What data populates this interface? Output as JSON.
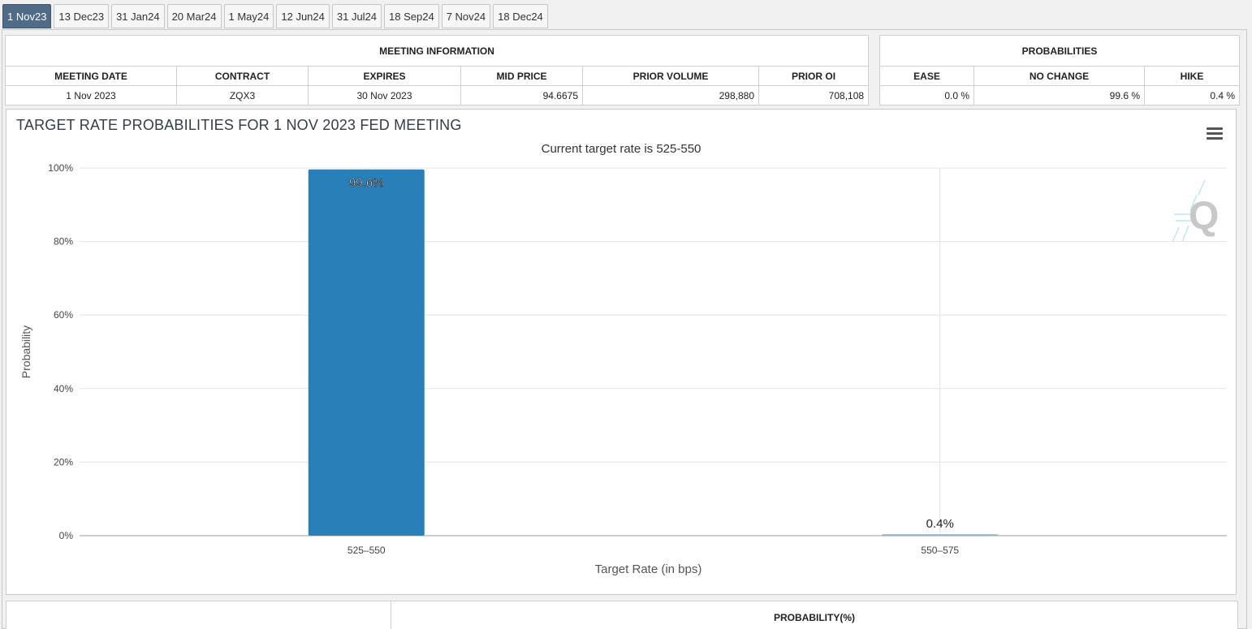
{
  "tabs": [
    {
      "label": "1 Nov23",
      "active": true
    },
    {
      "label": "13 Dec23",
      "active": false
    },
    {
      "label": "31 Jan24",
      "active": false
    },
    {
      "label": "20 Mar24",
      "active": false
    },
    {
      "label": "1 May24",
      "active": false
    },
    {
      "label": "12 Jun24",
      "active": false
    },
    {
      "label": "31 Jul24",
      "active": false
    },
    {
      "label": "18 Sep24",
      "active": false
    },
    {
      "label": "7 Nov24",
      "active": false
    },
    {
      "label": "18 Dec24",
      "active": false
    }
  ],
  "meeting_info": {
    "title": "MEETING INFORMATION",
    "headers": [
      "MEETING DATE",
      "CONTRACT",
      "EXPIRES",
      "MID PRICE",
      "PRIOR VOLUME",
      "PRIOR OI"
    ],
    "row": [
      "1 Nov 2023",
      "ZQX3",
      "30 Nov 2023",
      "94.6675",
      "298,880",
      "708,108"
    ]
  },
  "probabilities": {
    "title": "PROBABILITIES",
    "headers": [
      "EASE",
      "NO CHANGE",
      "HIKE"
    ],
    "row": [
      "0.0 %",
      "99.6 %",
      "0.4 %"
    ]
  },
  "chart": {
    "title": "TARGET RATE PROBABILITIES FOR 1 NOV 2023 FED MEETING",
    "subtitle": "Current target rate is 525-550",
    "menu_icon": "hamburger-menu-icon",
    "logo_icon": "q-logo-icon"
  },
  "chart_data": {
    "type": "bar",
    "title": "TARGET RATE PROBABILITIES FOR 1 NOV 2023 FED MEETING",
    "subtitle": "Current target rate is 525-550",
    "categories": [
      "525-550",
      "550-575"
    ],
    "values": [
      99.6,
      0.4
    ],
    "data_labels": [
      "99.6%",
      "0.4%"
    ],
    "xlabel": "Target Rate (in bps)",
    "ylabel": "Probability",
    "ylim": [
      0,
      100
    ],
    "yticks": [
      "0%",
      "20%",
      "40%",
      "60%",
      "80%",
      "100%"
    ],
    "grid": true,
    "colors": [
      "#2980b9",
      "#8fb3c9"
    ]
  },
  "bottom_table": {
    "header": "PROBABILITY(%)"
  }
}
